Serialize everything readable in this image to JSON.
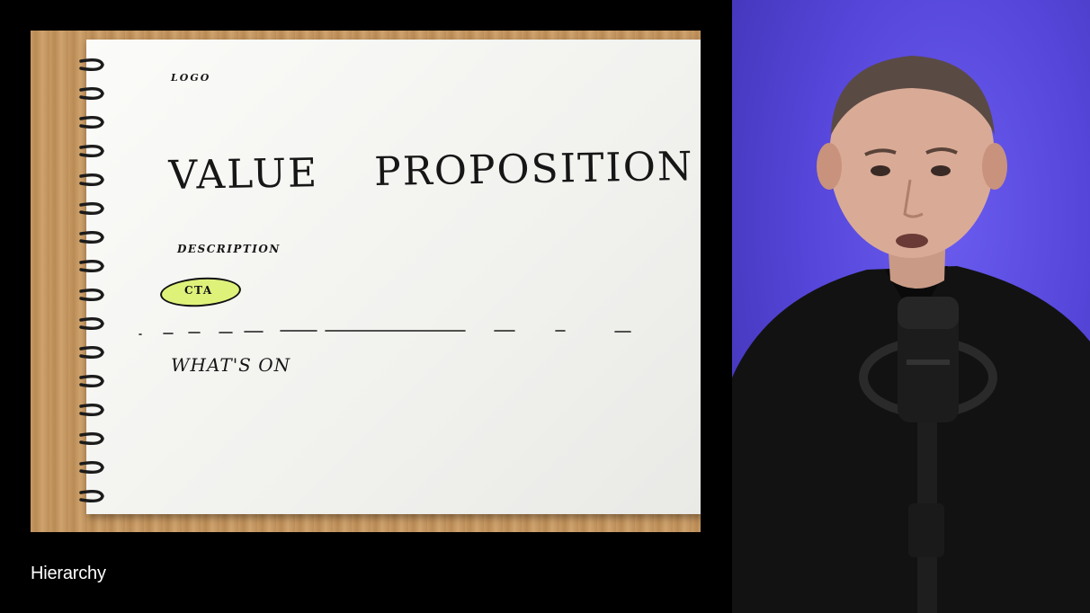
{
  "caption": "Hierarchy",
  "sketch": {
    "logo": "LOGO",
    "headline_word_1": "VALUE",
    "headline_word_2": "PROPOSITION",
    "description": "DESCRIPTION",
    "cta": "CTA",
    "section_heading": "WHAT'S ON"
  },
  "colors": {
    "background": "#000000",
    "cta_highlight": "#def27a",
    "webcam_backdrop": "#5646da"
  }
}
